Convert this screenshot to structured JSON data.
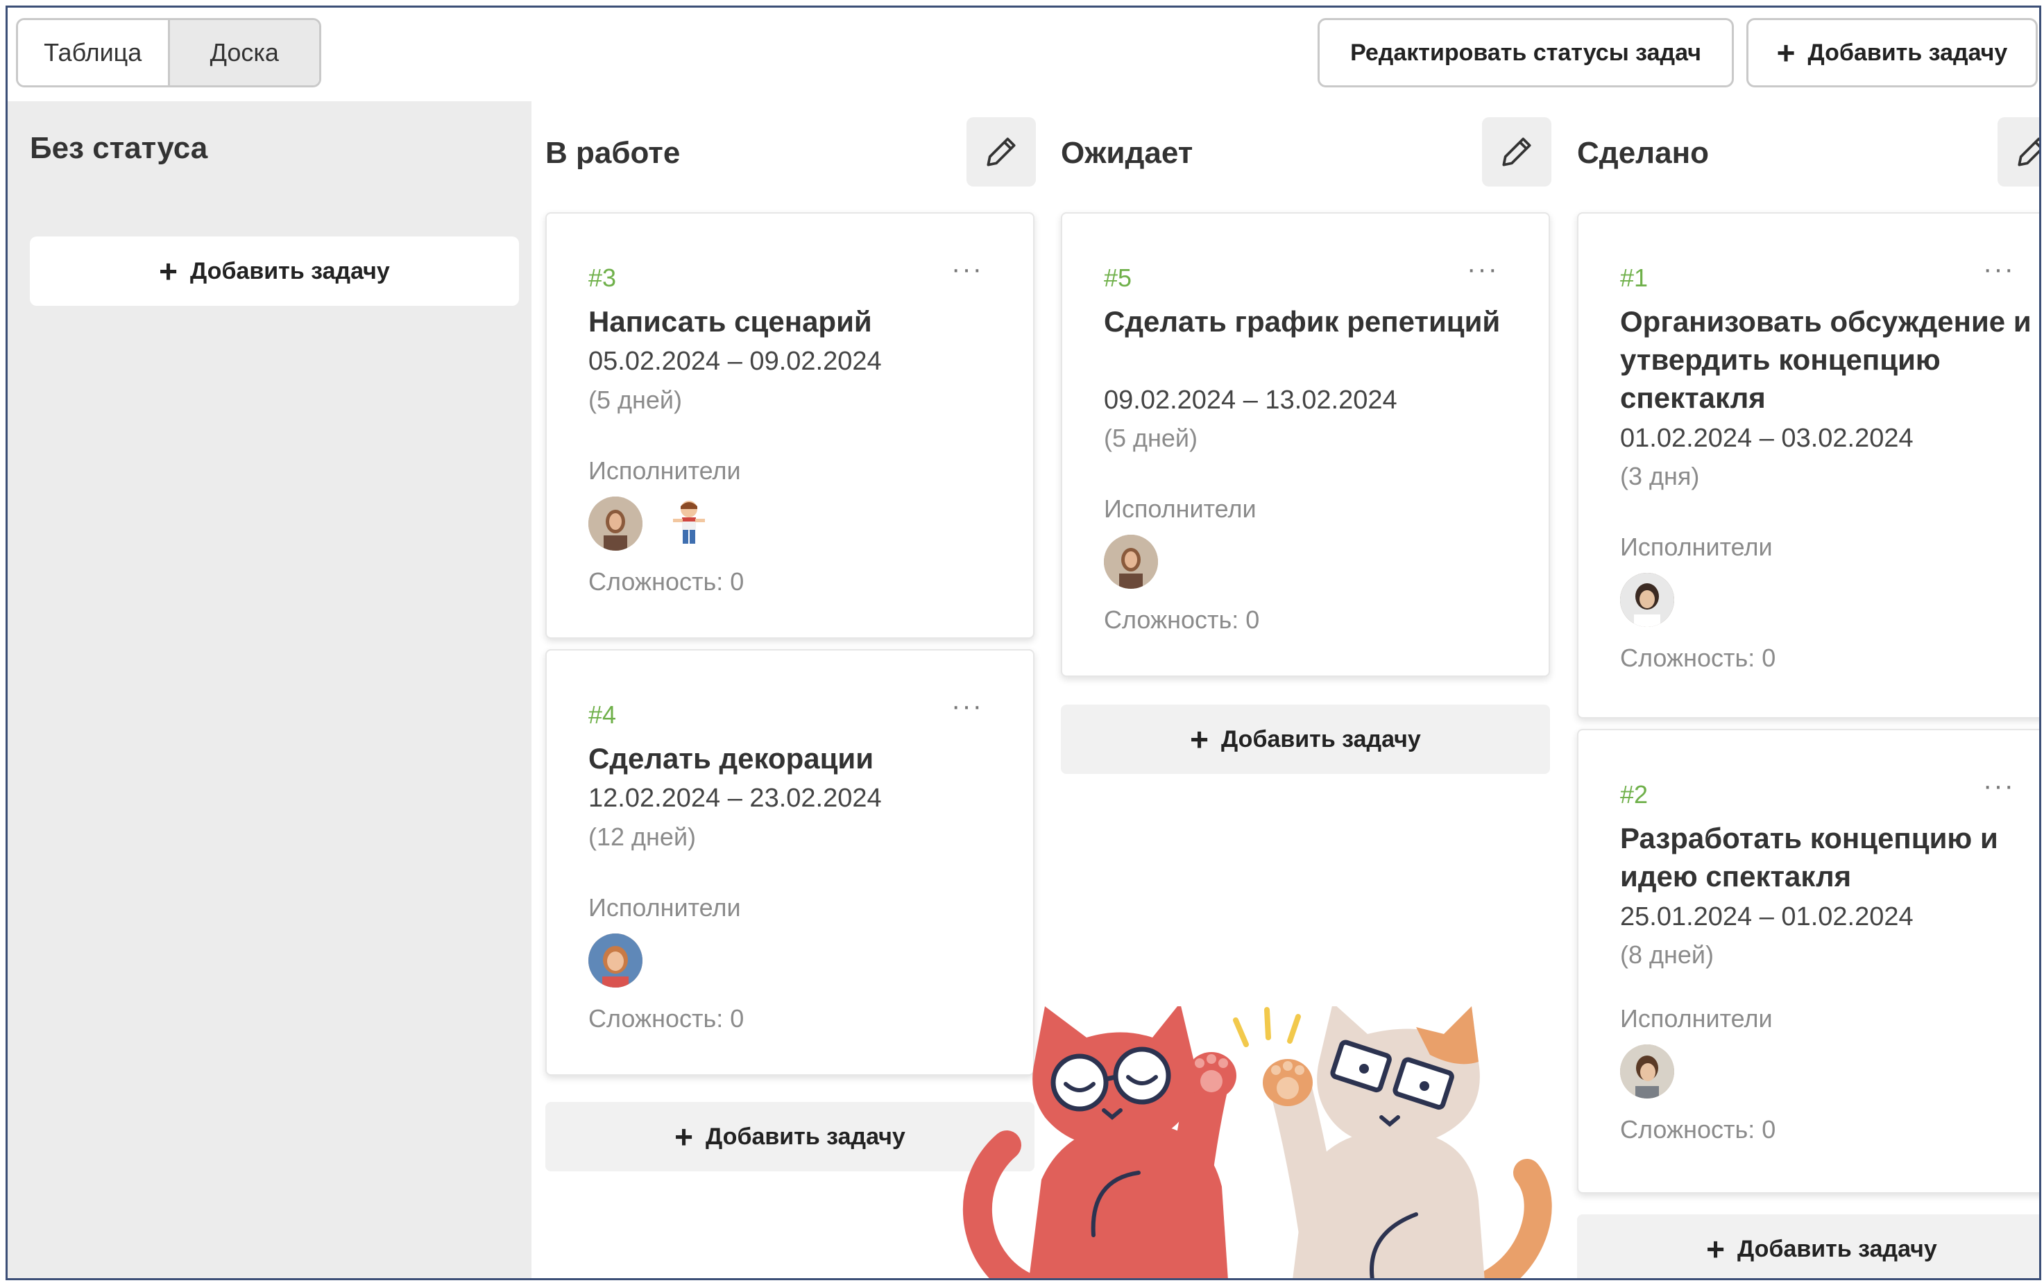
{
  "toolbar": {
    "view_table": "Таблица",
    "view_board": "Доска",
    "edit_statuses": "Редактировать статусы задач",
    "add_task": "Добавить задачу"
  },
  "columns": [
    {
      "title": "Без статуса",
      "add_label": "Добавить задачу"
    },
    {
      "title": "В работе",
      "add_label": "Добавить задачу"
    },
    {
      "title": "Ожидает",
      "add_label": "Добавить задачу"
    },
    {
      "title": "Сделано",
      "add_label": "Добавить задачу"
    }
  ],
  "cards": {
    "c3": {
      "num": "#3",
      "menu": "···",
      "title": "Написать сценарий",
      "dates": "05.02.2024 – 09.02.2024",
      "duration": "(5 дней)",
      "assignees_label": "Исполнители",
      "difficulty": "Сложность: 0"
    },
    "c4": {
      "num": "#4",
      "menu": "···",
      "title": "Сделать декорации",
      "dates": "12.02.2024 – 23.02.2024",
      "duration": "(12 дней)",
      "assignees_label": "Исполнители",
      "difficulty": "Сложность: 0"
    },
    "c5": {
      "num": "#5",
      "menu": "···",
      "title": "Сделать график репетиций",
      "dates": "09.02.2024 – 13.02.2024",
      "duration": "(5 дней)",
      "assignees_label": "Исполнители",
      "difficulty": "Сложность: 0"
    },
    "c1": {
      "num": "#1",
      "menu": "···",
      "title": "Организовать обсуждение и утвердить концепцию спектакля",
      "dates": "01.02.2024 – 03.02.2024",
      "duration": "(3 дня)",
      "assignees_label": "Исполнители",
      "difficulty": "Сложность: 0"
    },
    "c2": {
      "num": "#2",
      "menu": "···",
      "title": "Разработать концепцию и идею спектакля",
      "dates": "25.01.2024 – 01.02.2024",
      "duration": "(8 дней)",
      "assignees_label": "Исполнители",
      "difficulty": "Сложность: 0"
    }
  },
  "icons": {
    "plus": "+",
    "edit": "pencil-icon",
    "menu": "ellipsis-icon"
  },
  "colors": {
    "task_number": "#6fb04a",
    "column_bg": "#ececec",
    "cat_red": "#e0605a",
    "cat_beige": "#e8d9cf"
  }
}
